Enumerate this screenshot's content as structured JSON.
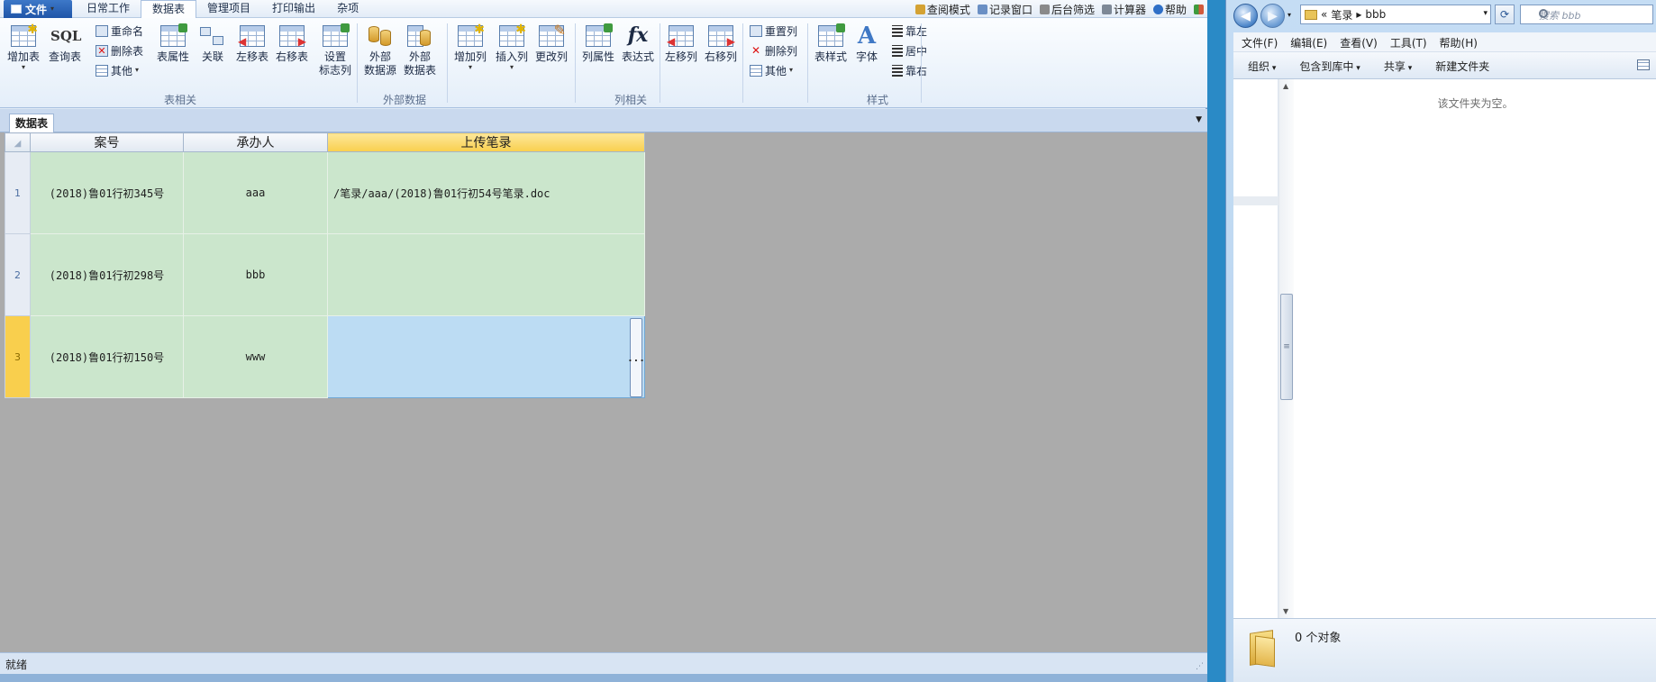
{
  "app": {
    "file_menu": "文件",
    "tabs": [
      "日常工作",
      "数据表",
      "管理项目",
      "打印输出",
      "杂项"
    ],
    "active_tab": "数据表",
    "right_menu": [
      "查阅模式",
      "记录窗口",
      "后台筛选",
      "计算器",
      "帮助"
    ],
    "ribbon": {
      "group1": {
        "add_table": "增加表",
        "sql_icon": "SQL",
        "query_table": "查询表",
        "rename": "重命名",
        "delete_table": "删除表",
        "other": "其他",
        "table_props": "表属性",
        "relate": "关联",
        "move_left": "左移表",
        "move_right": "右移表",
        "set_flag_col_1": "设置",
        "set_flag_col_2": "标志列",
        "label": "表相关"
      },
      "group2": {
        "ext_source_1": "外部",
        "ext_source_2": "数据源",
        "ext_table_1": "外部",
        "ext_table_2": "数据表",
        "label": "外部数据"
      },
      "group3": {
        "add_col": "增加列",
        "insert_col": "插入列",
        "edit_col": "更改列",
        "col_props": "列属性",
        "fx_icon": "fx",
        "expression": "表达式",
        "col_left": "左移列",
        "col_right": "右移列",
        "reset_col": "重置列",
        "delete_col": "删除列",
        "other": "其他",
        "label": "列相关"
      },
      "group4": {
        "table_style": "表样式",
        "font_icon": "A",
        "font": "字体",
        "align_left": "靠左",
        "align_center": "居中",
        "align_right": "靠右",
        "label": "样式"
      }
    },
    "sheet_tab": "数据表",
    "grid": {
      "columns": [
        "案号",
        "承办人",
        "上传笔录"
      ],
      "active_column": 2,
      "rows": [
        {
          "num": "1",
          "case": "(2018)鲁01行初345号",
          "person": "aaa",
          "upload": "/笔录/aaa/(2018)鲁01行初54号笔录.doc"
        },
        {
          "num": "2",
          "case": "(2018)鲁01行初298号",
          "person": "bbb",
          "upload": ""
        },
        {
          "num": "3",
          "case": "(2018)鲁01行初150号",
          "person": "www",
          "upload": ""
        }
      ],
      "selected_row": 3,
      "ellipsis": "..."
    },
    "status": "就绪"
  },
  "explorer": {
    "address_prefix": "«",
    "address_folder": "笔录",
    "address_sep": "▸",
    "address_sub": "bbb",
    "search_placeholder": "搜索 bbb",
    "menu": [
      "文件(F)",
      "编辑(E)",
      "查看(V)",
      "工具(T)",
      "帮助(H)"
    ],
    "toolbar": [
      "组织",
      "包含到库中",
      "共享",
      "新建文件夹"
    ],
    "empty_message": "该文件夹为空。",
    "object_count": "0 个对象"
  },
  "colors": {
    "grid_bg": "#cbe6cc",
    "active_header": "#f9cf4d",
    "selected_cell": "#bcdcf3",
    "workspace": "#ababab"
  }
}
